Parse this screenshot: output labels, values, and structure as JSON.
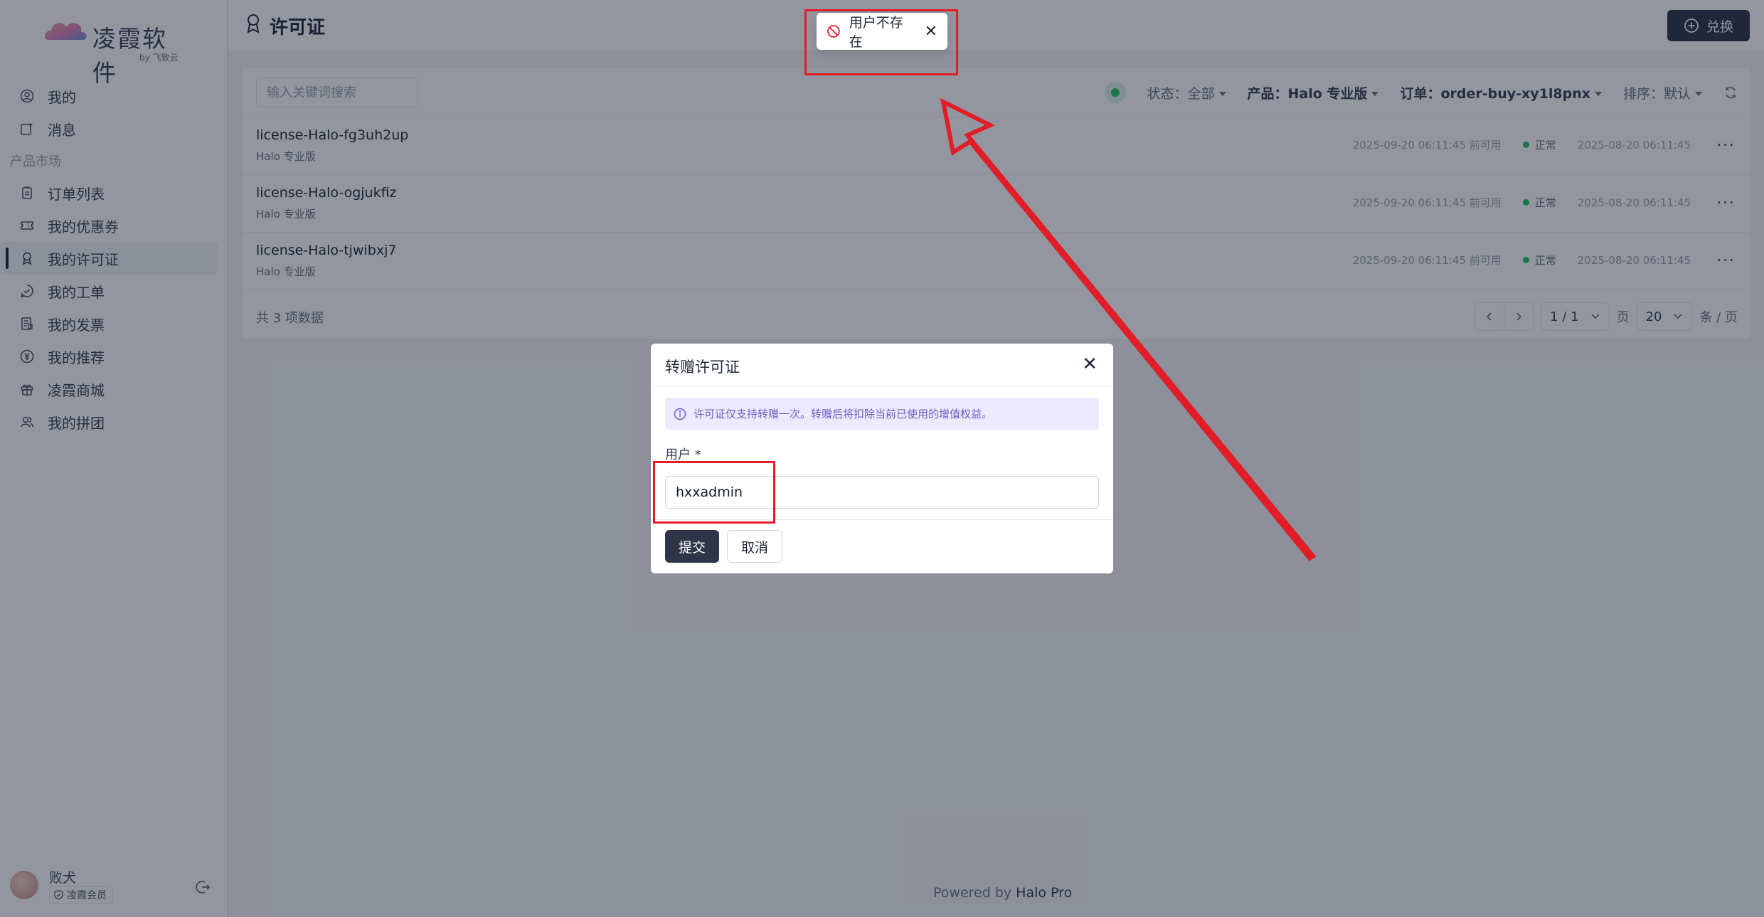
{
  "brand": {
    "name": "凌霞软件",
    "sub": "by 飞致云"
  },
  "nav": {
    "items_top": [
      {
        "label": "我的",
        "icon": "user-circle-icon"
      },
      {
        "label": "消息",
        "icon": "message-icon"
      }
    ],
    "group_label": "产品市场",
    "items": [
      {
        "label": "订单列表",
        "icon": "clipboard-icon"
      },
      {
        "label": "我的优惠券",
        "icon": "ticket-icon"
      },
      {
        "label": "我的许可证",
        "icon": "award-icon"
      },
      {
        "label": "我的工单",
        "icon": "checkmark-bubble-icon"
      },
      {
        "label": "我的发票",
        "icon": "invoice-icon"
      },
      {
        "label": "我的推荐",
        "icon": "yen-icon"
      },
      {
        "label": "凌霞商城",
        "icon": "gift-icon"
      },
      {
        "label": "我的拼团",
        "icon": "users-icon"
      }
    ],
    "active_item": "我的许可证"
  },
  "user": {
    "name": "败犬",
    "badge": "凌霞会员"
  },
  "header": {
    "title": "许可证",
    "redeem_label": "兑换"
  },
  "toolbar": {
    "search_placeholder": "输入关键词搜索",
    "status_label": "状态：全部",
    "product_label": "产品：Halo 专业版",
    "order_label": "订单：order-buy-xy1l8pnx",
    "sort_label": "排序：默认"
  },
  "licenses": [
    {
      "name": "license-Halo-fg3uh2up",
      "product": "Halo 专业版",
      "available": "2025-09-20 06:11:45 前可用",
      "status": "正常",
      "created": "2025-08-20 06:11:45"
    },
    {
      "name": "license-Halo-ogjukfiz",
      "product": "Halo 专业版",
      "available": "2025-09-20 06:11:45 前可用",
      "status": "正常",
      "created": "2025-08-20 06:11:45"
    },
    {
      "name": "license-Halo-tjwibxj7",
      "product": "Halo 专业版",
      "available": "2025-09-20 06:11:45 前可用",
      "status": "正常",
      "created": "2025-08-20 06:11:45"
    }
  ],
  "pagination": {
    "total": "共 3 项数据",
    "page": "1 / 1",
    "page_unit": "页",
    "size": "20",
    "size_unit": "条 / 页"
  },
  "footer": {
    "prefix": "Powered by",
    "brand": "Halo Pro"
  },
  "toast": {
    "message": "用户不存在"
  },
  "modal": {
    "title": "转赠许可证",
    "notice": "许可证仅支持转赠一次。转赠后将扣除当前已使用的增值权益。",
    "field_label": "用户 *",
    "field_value": "hxxadmin",
    "submit_label": "提交",
    "cancel_label": "取消"
  },
  "colors": {
    "annotation": "#e11d27",
    "primary": "#2f3547",
    "success": "#22c55e",
    "notice_bg": "#ede9fe"
  }
}
